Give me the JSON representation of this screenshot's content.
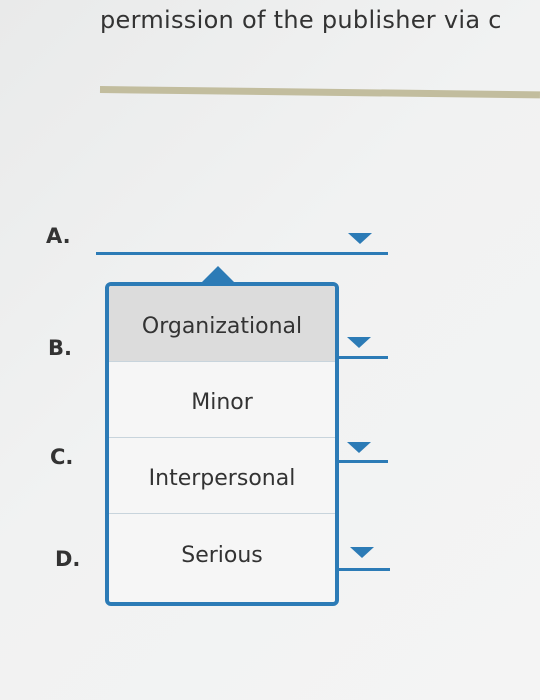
{
  "header": {
    "text": "permission of the publisher via c"
  },
  "questions": [
    {
      "label": "A."
    },
    {
      "label": "B."
    },
    {
      "label": "C."
    },
    {
      "label": "D."
    }
  ],
  "dropdown": {
    "options": [
      "Organizational",
      "Minor",
      "Interpersonal",
      "Serious"
    ],
    "highlighted_option": "Organizational"
  },
  "colors": {
    "accent": "#2c7bb6",
    "divider": "#c2bd9e",
    "highlight": "#dcdcdc"
  }
}
